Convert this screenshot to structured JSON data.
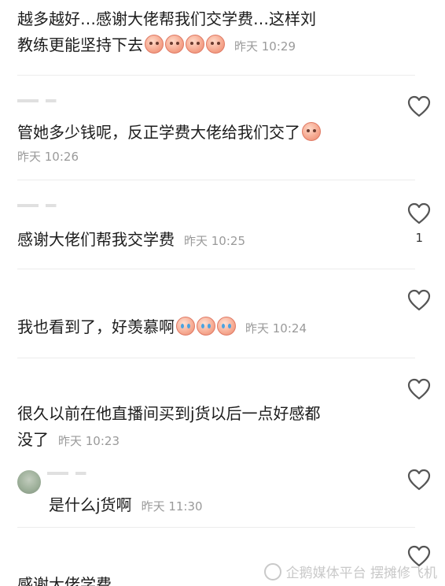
{
  "comments": [
    {
      "text": "越多越好…感谢大佬帮我们交学费…这样刘\n教练更能坚持下去",
      "emoji_count": 4,
      "time": "昨天 10:29"
    },
    {
      "text": "管她多少钱呢，反正学费大佬给我们交了",
      "emoji_count": 1,
      "time": "昨天 10:26"
    },
    {
      "text": "感谢大佬们帮我交学费",
      "time": "昨天 10:25",
      "likes": "1"
    },
    {
      "text": "我也看到了，好羡慕啊",
      "emoji_count": 3,
      "time": "昨天 10:24"
    },
    {
      "text": "很久以前在他直播间买到j货以后一点好感都\n没了",
      "time": "昨天 10:23"
    },
    {
      "text": "是什么j货啊",
      "time": "昨天 11:30"
    },
    {
      "text": "感谢大佬学费"
    }
  ],
  "icons": {
    "like": "heart-outline-icon",
    "emoji_smile": "peach-face-emoji",
    "emoji_cry": "crying-face-emoji",
    "watermark": "qiee-logo-icon"
  },
  "colors": {
    "text": "#1c1c1c",
    "time": "#9a9a9a",
    "heart_stroke": "#555555",
    "divider": "#ececec"
  },
  "watermark": {
    "text": "企鹅媒体平台 摆摊修飞机"
  }
}
